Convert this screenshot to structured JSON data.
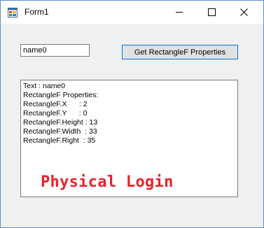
{
  "window": {
    "title": "Form1",
    "icon": "winforms-form-icon",
    "accent_border": "#5a8fd6"
  },
  "titlebar_buttons": {
    "minimize_icon": "minimize-icon",
    "maximize_icon": "maximize-icon",
    "close_icon": "close-icon"
  },
  "input": {
    "value": "name0"
  },
  "button": {
    "label": "Get RectangleF Properties"
  },
  "output": {
    "lines": [
      "Text : name0",
      "RectangleF Properties:",
      "RectangleF.X      : 2",
      "RectangleF.Y      : 0",
      "RectangleF.Height : 13",
      "RectangleF.Width  : 33",
      "RectangleF.Right  : 35"
    ]
  },
  "watermark": {
    "text": "Physical Login",
    "color": "#e8222a"
  }
}
